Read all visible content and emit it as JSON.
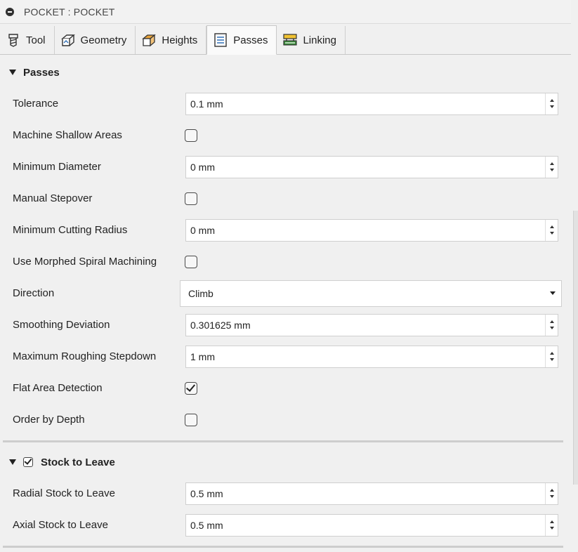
{
  "window": {
    "title": "POCKET : POCKET"
  },
  "tabs": [
    {
      "label": "Tool",
      "icon": "tool-icon",
      "active": false
    },
    {
      "label": "Geometry",
      "icon": "geometry-icon",
      "active": false
    },
    {
      "label": "Heights",
      "icon": "heights-icon",
      "active": false
    },
    {
      "label": "Passes",
      "icon": "passes-icon",
      "active": true
    },
    {
      "label": "Linking",
      "icon": "linking-icon",
      "active": false
    }
  ],
  "passes": {
    "header": "Passes",
    "tolerance": {
      "label": "Tolerance",
      "value": "0.1 mm"
    },
    "machine_shallow": {
      "label": "Machine Shallow Areas",
      "checked": false
    },
    "min_diameter": {
      "label": "Minimum Diameter",
      "value": "0 mm"
    },
    "manual_stepover": {
      "label": "Manual Stepover",
      "checked": false
    },
    "min_cutting_radius": {
      "label": "Minimum Cutting Radius",
      "value": "0 mm"
    },
    "morphed_spiral": {
      "label": "Use Morphed Spiral Machining",
      "checked": false
    },
    "direction": {
      "label": "Direction",
      "value": "Climb"
    },
    "smoothing": {
      "label": "Smoothing Deviation",
      "value": "0.301625 mm"
    },
    "max_stepdown": {
      "label": "Maximum Roughing Stepdown",
      "value": "1 mm"
    },
    "flat_area": {
      "label": "Flat Area Detection",
      "checked": true
    },
    "order_depth": {
      "label": "Order by Depth",
      "checked": false
    }
  },
  "stock": {
    "header": "Stock to Leave",
    "enabled": true,
    "radial": {
      "label": "Radial Stock to Leave",
      "value": "0.5 mm"
    },
    "axial": {
      "label": "Axial Stock to Leave",
      "value": "0.5 mm"
    }
  },
  "colors": {
    "accent_orange": "#e8a33a",
    "accent_green": "#3a8f3a",
    "accent_yellow": "#f1c232",
    "accent_blue": "#2f6fb5"
  }
}
